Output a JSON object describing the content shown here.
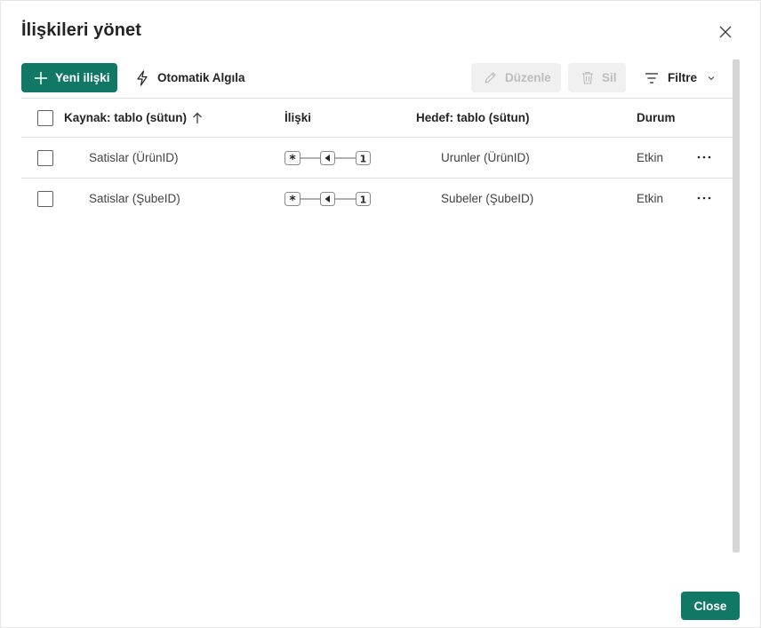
{
  "dialog": {
    "title": "İlişkileri yönet",
    "close_icon": "close-icon"
  },
  "toolbar": {
    "new_label": "Yeni ilişki",
    "auto_label": "Otomatik Algıla",
    "edit_label": "Düzenle",
    "delete_label": "Sil",
    "filter_label": "Filtre"
  },
  "table": {
    "headers": {
      "source": "Kaynak: tablo (sütun)",
      "relationship": "İlişki",
      "target": "Hedef: tablo (sütun)",
      "status": "Durum"
    },
    "rows": [
      {
        "source": "Satislar (ÜrünID)",
        "left_card": "*",
        "right_card": "1",
        "target": "Urunler (ÜrünID)",
        "status": "Etkin"
      },
      {
        "source": "Satislar (ŞubeID)",
        "left_card": "*",
        "right_card": "1",
        "target": "Subeler (ŞubeID)",
        "status": "Etkin"
      }
    ]
  },
  "footer": {
    "close_label": "Close"
  },
  "colors": {
    "accent": "#117865",
    "disabled_bg": "#f0f0f0",
    "disabled_text": "#bdbdbd"
  }
}
